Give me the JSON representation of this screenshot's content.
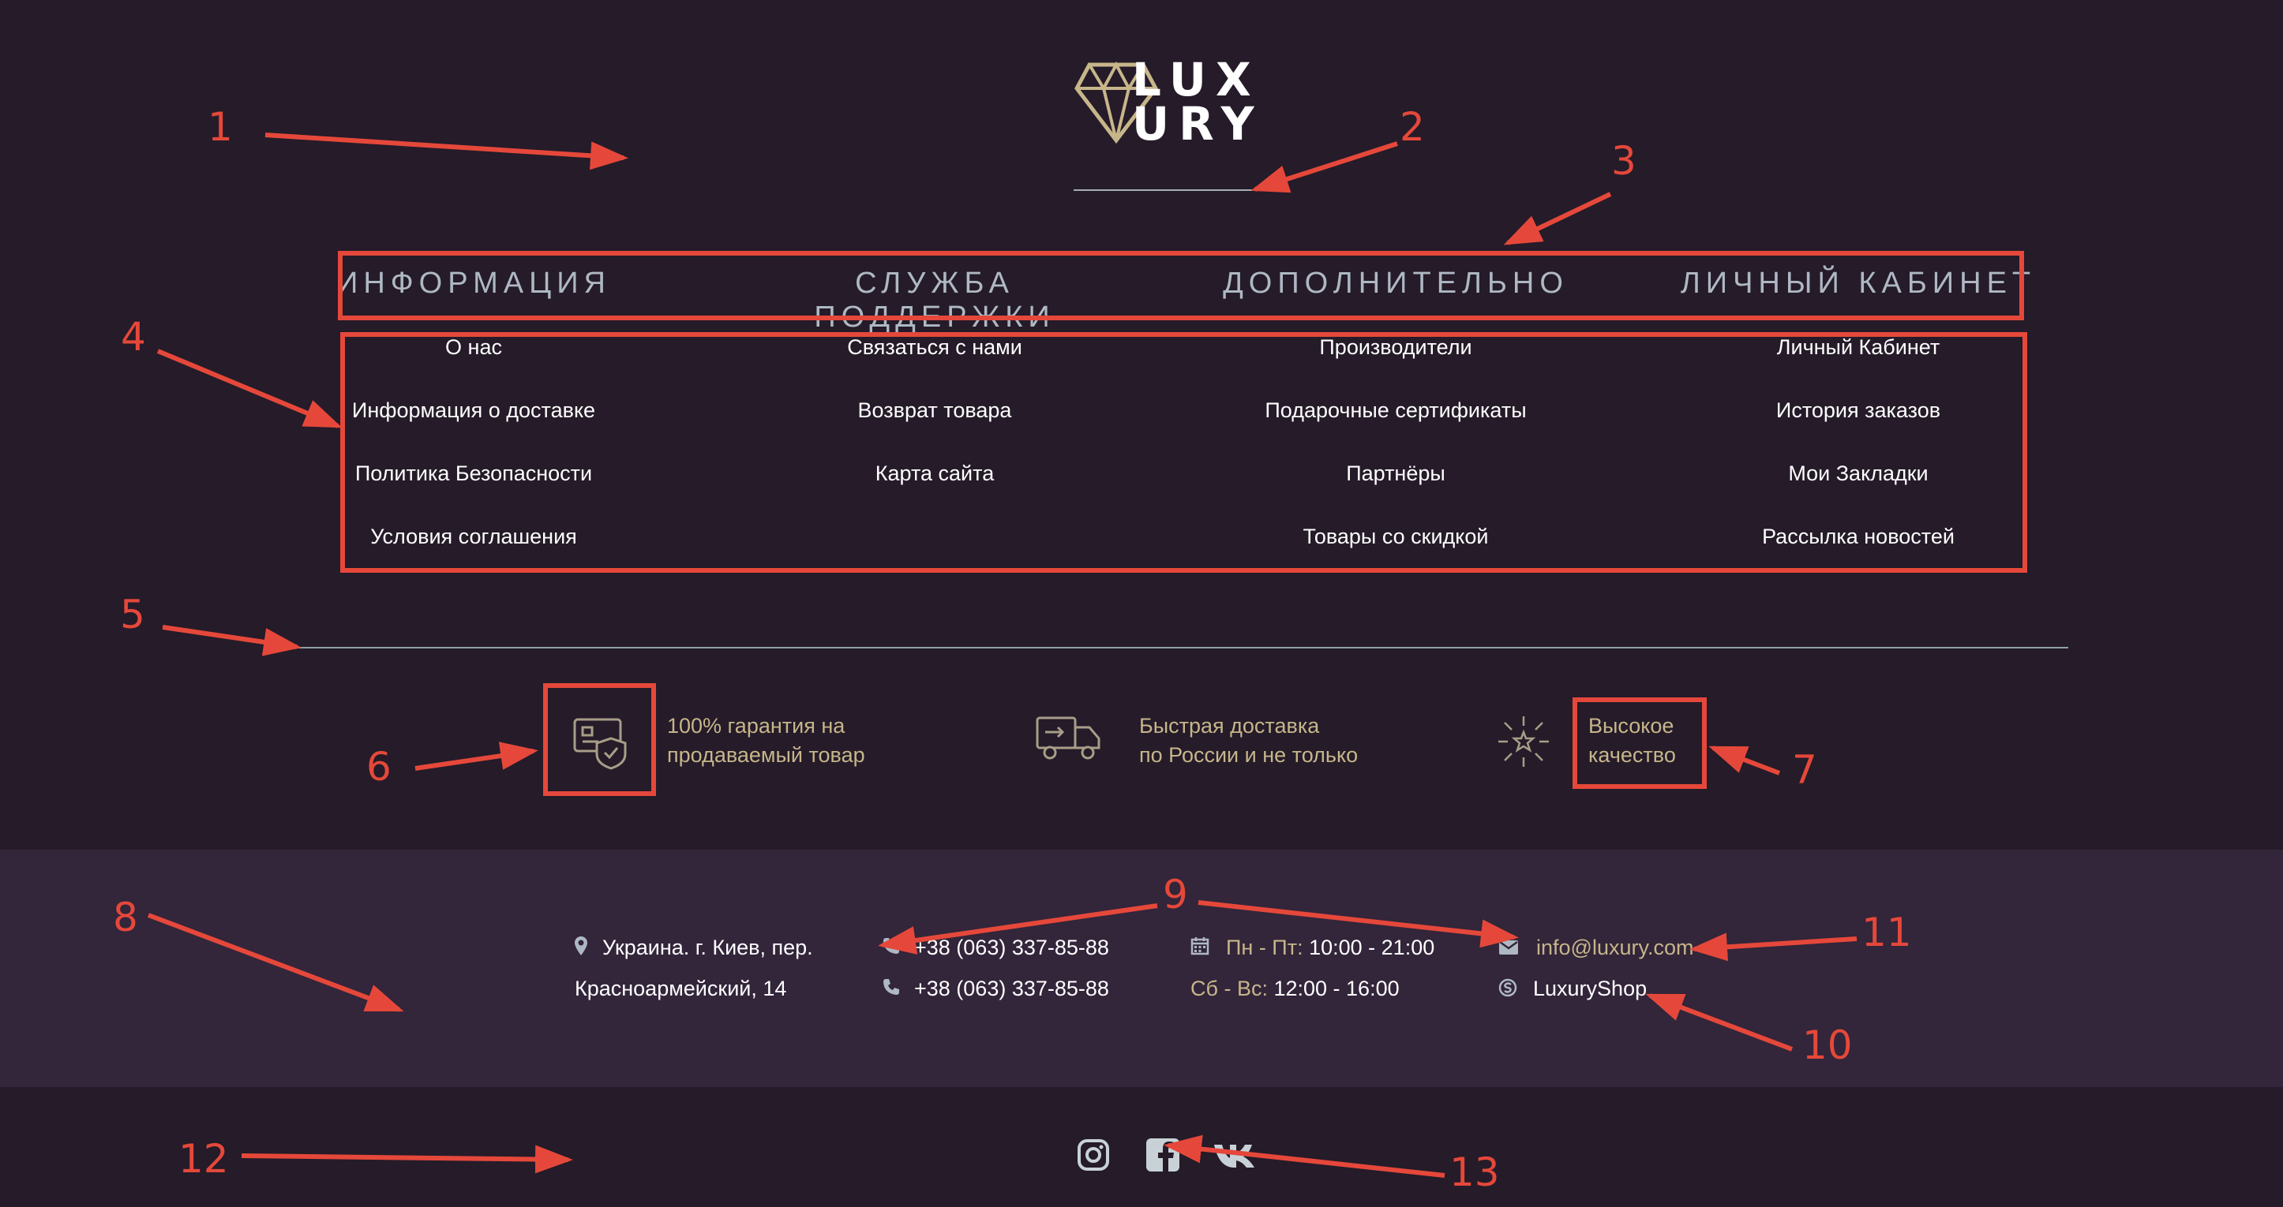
{
  "logo": {
    "line1": "LUX",
    "line2": "URY"
  },
  "nav": {
    "columns": [
      {
        "title": "ИНФОРМАЦИЯ",
        "links": [
          "О нас",
          "Информация о доставке",
          "Политика Безопасности",
          "Условия соглашения"
        ]
      },
      {
        "title": "СЛУЖБА ПОДДЕРЖКИ",
        "links": [
          "Связаться с нами",
          "Возврат товара",
          "Карта сайта"
        ]
      },
      {
        "title": "ДОПОЛНИТЕЛЬНО",
        "links": [
          "Производители",
          "Подарочные сертификаты",
          "Партнёры",
          "Товары со скидкой"
        ]
      },
      {
        "title": "ЛИЧНЫЙ КАБИНЕТ",
        "links": [
          "Личный Кабинет",
          "История заказов",
          "Мои Закладки",
          "Рассылка новостей"
        ]
      }
    ]
  },
  "features": [
    {
      "icon": "card-shield-icon",
      "line1": "100% гарантия на",
      "line2": "продаваемый товар"
    },
    {
      "icon": "truck-icon",
      "line1": "Быстрая доставка",
      "line2": "по России и не только"
    },
    {
      "icon": "sparkle-star-icon",
      "line1": "Высокое",
      "line2": "качество"
    }
  ],
  "contact": {
    "address_line1": "Украина. г. Киев, пер.",
    "address_line2": "Красноармейский, 14",
    "phone1": "+38 (063) 337-85-88",
    "phone2": "+38 (063) 337-85-88",
    "weekday_label": "Пн - Пт:",
    "weekday_hours": "10:00 - 21:00",
    "weekend_label": "Сб - Вс:",
    "weekend_hours": "12:00 - 16:00",
    "email": "info@luxury.com",
    "skype": "LuxuryShop"
  },
  "social": [
    "instagram-icon",
    "facebook-icon",
    "vk-icon"
  ],
  "annotations": [
    "1",
    "2",
    "3",
    "4",
    "5",
    "6",
    "7",
    "8",
    "9",
    "10",
    "11",
    "12",
    "13"
  ],
  "colors": {
    "background": "#251b29",
    "contact_band": "#33253a",
    "gold_accent": "#c6b68a",
    "heading": "#aeb8c3",
    "annotation_red": "#e5483a"
  }
}
